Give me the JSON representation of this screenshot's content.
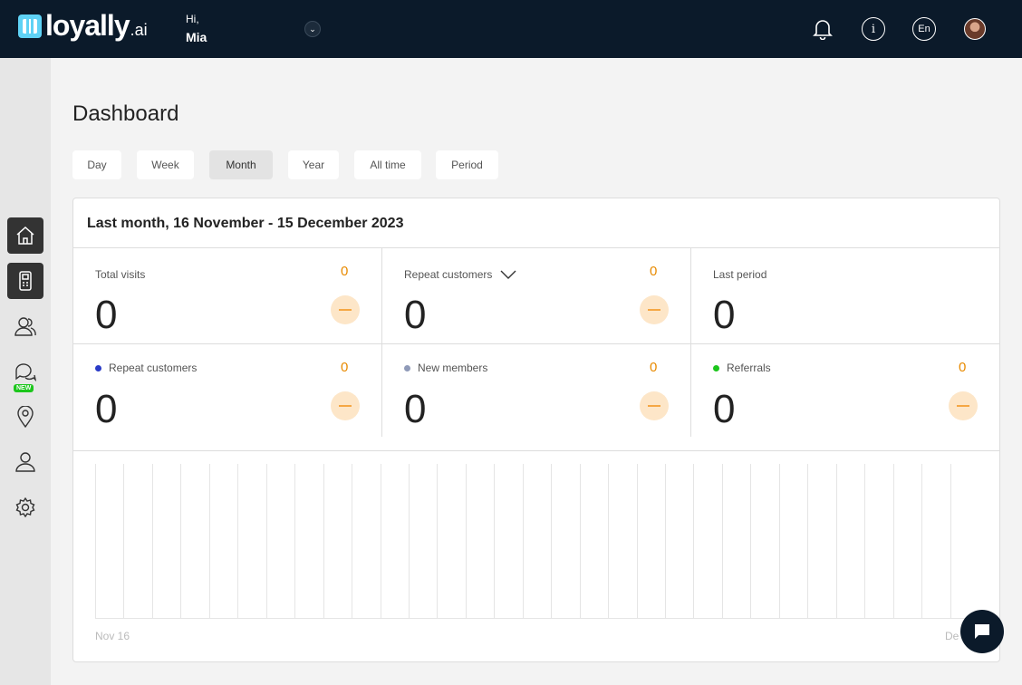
{
  "app": {
    "logo_text": "loyally",
    "logo_suffix": ".ai"
  },
  "header": {
    "greeting": "Hi,",
    "user_name": "Mia",
    "language": "En",
    "icons": [
      "bell-icon",
      "info-icon",
      "language-icon",
      "avatar"
    ]
  },
  "sidebar": {
    "items": [
      {
        "name": "home",
        "icon": "home-icon",
        "active": true
      },
      {
        "name": "terminal",
        "icon": "device-icon",
        "active": true
      },
      {
        "name": "customers",
        "icon": "users-icon",
        "active": false
      },
      {
        "name": "messages",
        "icon": "chat-icon",
        "active": false,
        "badge": "NEW"
      },
      {
        "name": "locations",
        "icon": "location-pin-icon",
        "active": false
      },
      {
        "name": "profile",
        "icon": "user-icon",
        "active": false
      },
      {
        "name": "settings",
        "icon": "gear-icon",
        "active": false
      }
    ]
  },
  "page": {
    "title": "Dashboard"
  },
  "periods": {
    "options": [
      "Day",
      "Week",
      "Month",
      "Year",
      "All time",
      "Period"
    ],
    "selected": "Month"
  },
  "card": {
    "heading": "Last month, 16 November - 15 December 2023",
    "stats_row1": [
      {
        "label": "Total visits",
        "value": "0",
        "delta": "0"
      },
      {
        "label": "Repeat customers",
        "value": "0",
        "delta": "0"
      },
      {
        "label": "Last period",
        "value": "0"
      }
    ],
    "stats_row2": [
      {
        "label": "Repeat customers",
        "value": "0",
        "delta": "0",
        "dot_color": "#2a3bc7"
      },
      {
        "label": "New members",
        "value": "0",
        "delta": "0",
        "dot_color": "#8f9ab8"
      },
      {
        "label": "Referrals",
        "value": "0",
        "delta": "0",
        "dot_color": "#1cc61c"
      }
    ]
  },
  "chart_data": {
    "type": "bar",
    "x_start_label": "Nov 16",
    "x_end_label": "De",
    "series": [
      {
        "values": [
          0,
          0,
          0,
          0,
          0,
          0,
          0,
          0,
          0,
          0,
          0,
          0,
          0,
          0,
          0,
          0,
          0,
          0,
          0,
          0,
          0,
          0,
          0,
          0,
          0,
          0,
          0,
          0,
          0,
          0,
          0
        ]
      }
    ]
  }
}
